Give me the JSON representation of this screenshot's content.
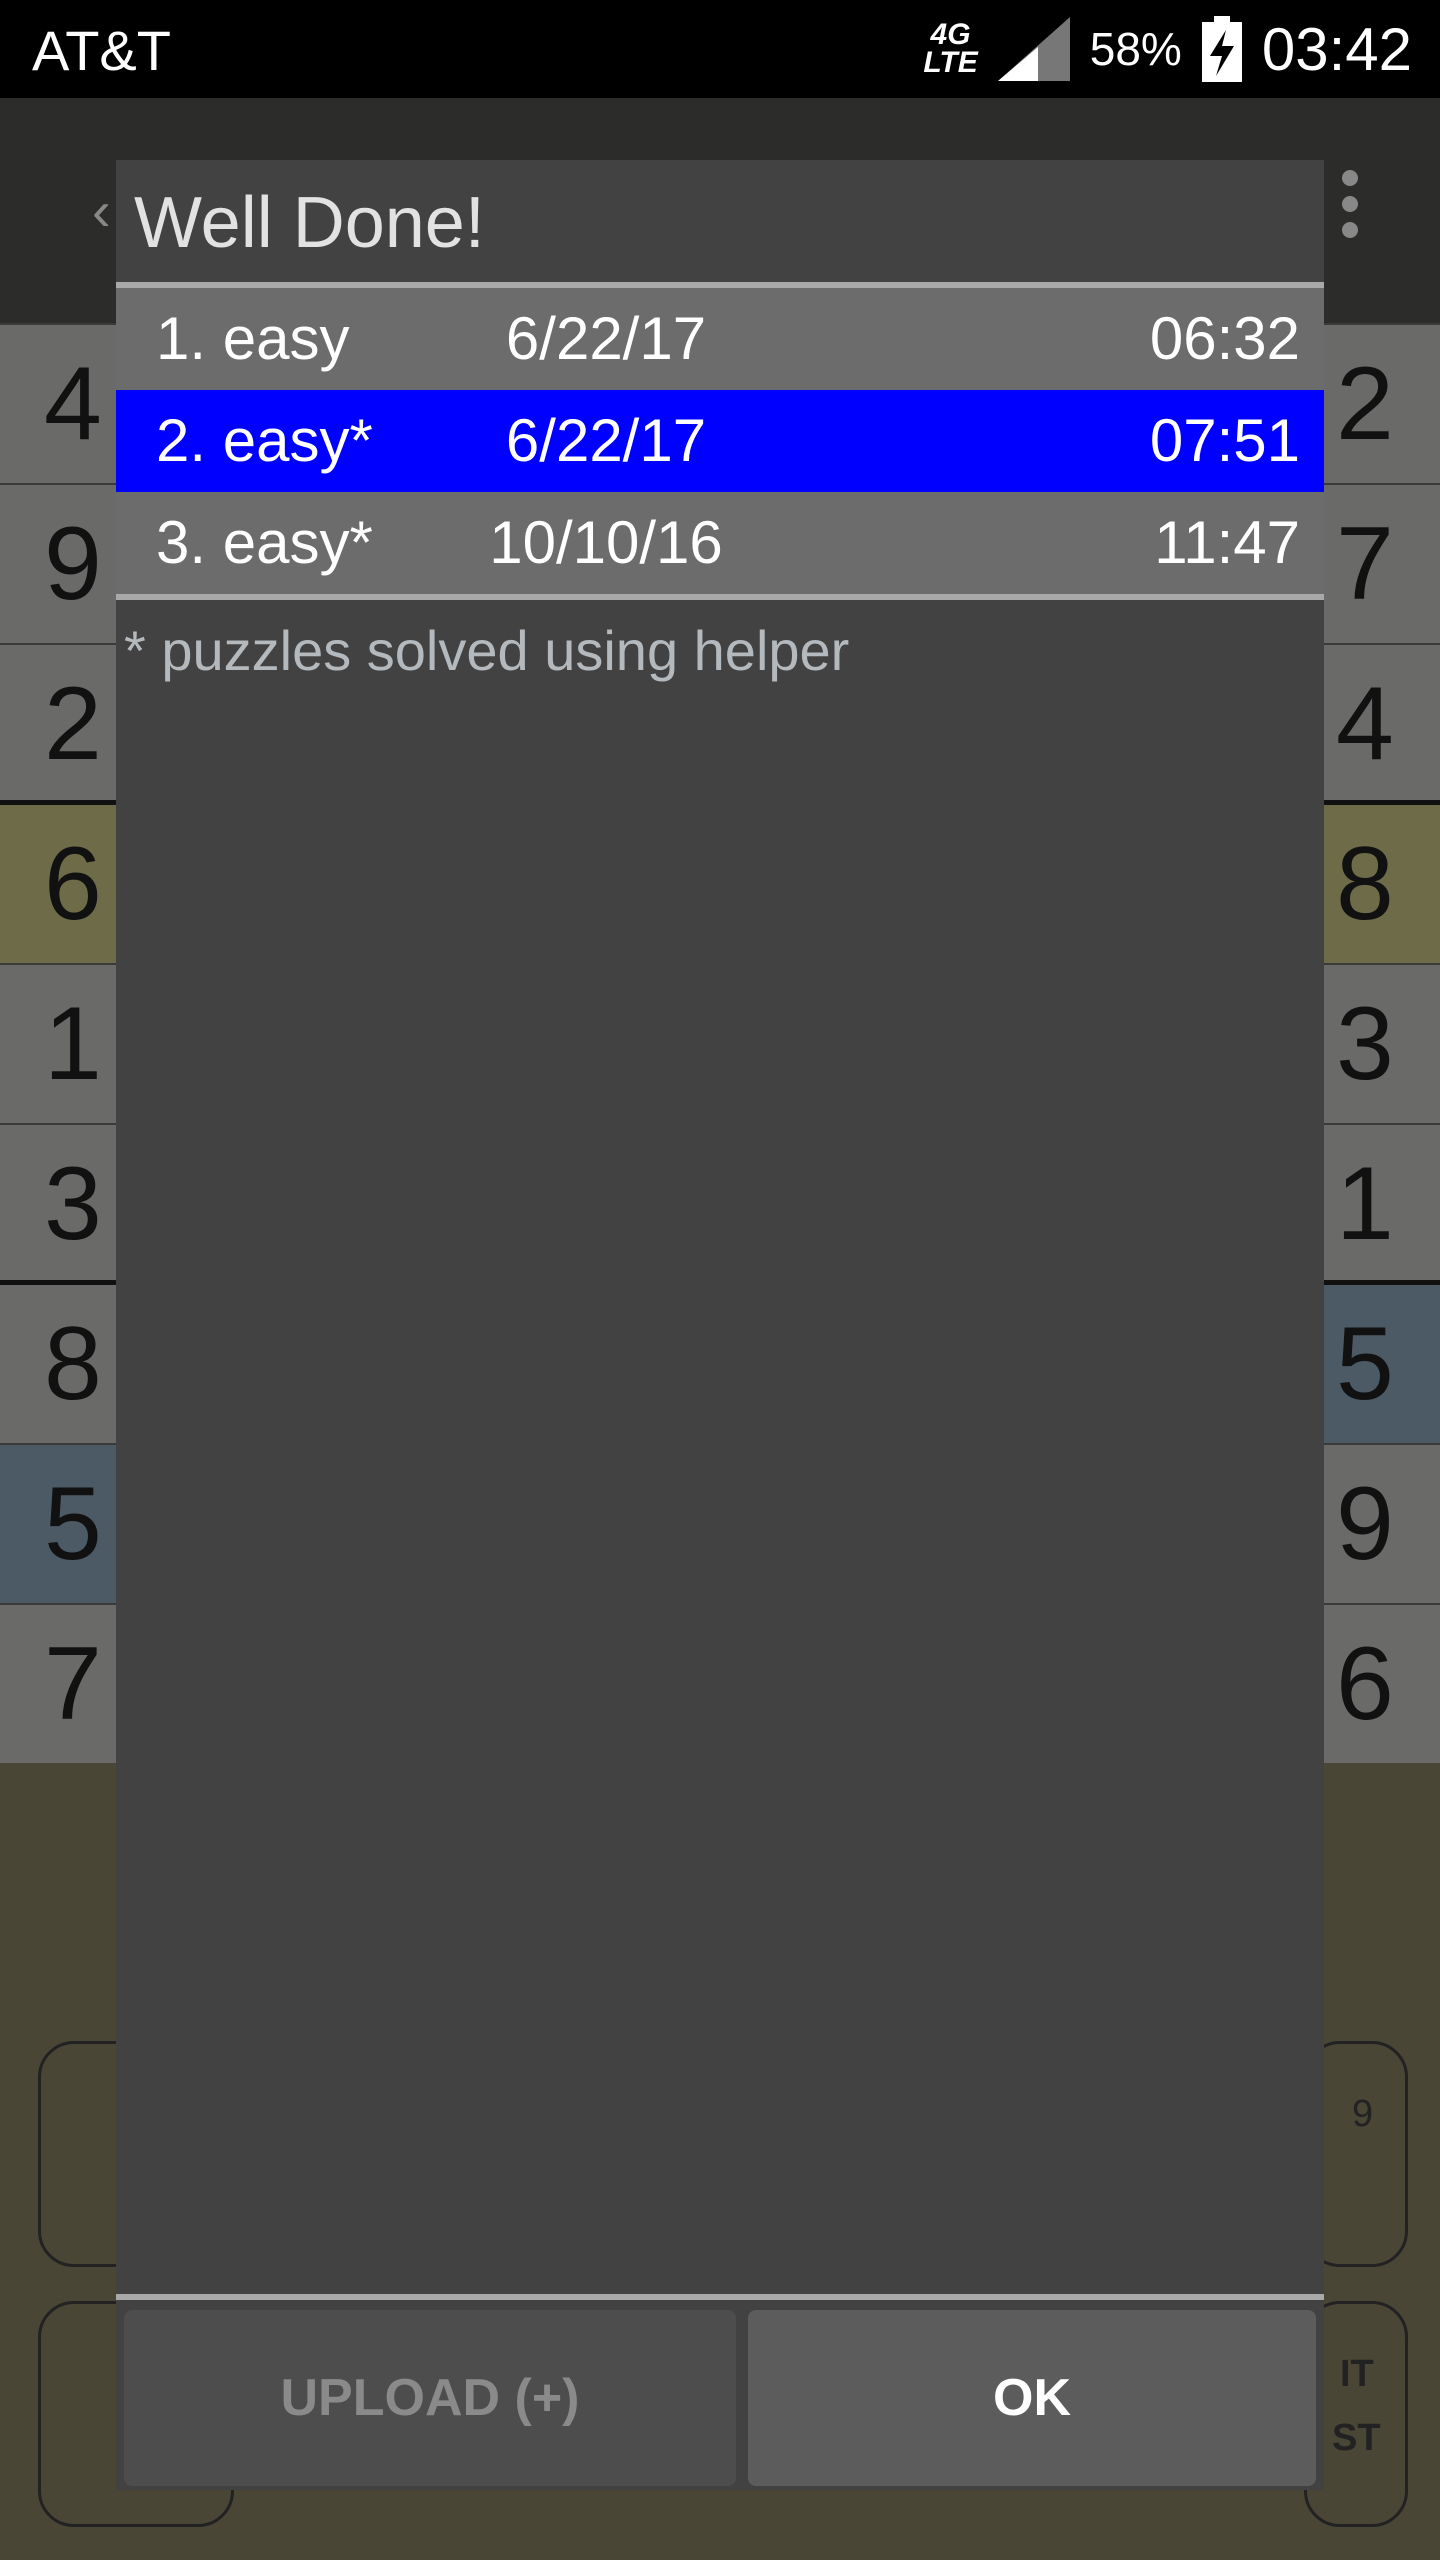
{
  "status_bar": {
    "carrier": "AT&T",
    "network": "4G LTE",
    "battery": "58%",
    "time": "03:42"
  },
  "background": {
    "left_column": [
      "4",
      "9",
      "2",
      "6",
      "1",
      "3",
      "8",
      "5",
      "7"
    ],
    "right_column": [
      "2",
      "7",
      "4",
      "8",
      "3",
      "1",
      "5",
      "9",
      "6"
    ],
    "keypad_fragments": [
      "9",
      "IT",
      "ST"
    ]
  },
  "dialog": {
    "title": "Well Done!",
    "rows": [
      {
        "name": "1. easy",
        "date": "6/22/17",
        "time": "06:32",
        "selected": false
      },
      {
        "name": "2. easy*",
        "date": "6/22/17",
        "time": "07:51",
        "selected": true
      },
      {
        "name": "3. easy*",
        "date": "10/10/16",
        "time": "11:47",
        "selected": false
      }
    ],
    "note": "* puzzles solved using helper",
    "upload_label": "UPLOAD (+)",
    "ok_label": "OK"
  },
  "colors": {
    "selected_row": "#0000ff",
    "row_bg": "#6c6c6c",
    "dialog_bg": "#424242"
  }
}
